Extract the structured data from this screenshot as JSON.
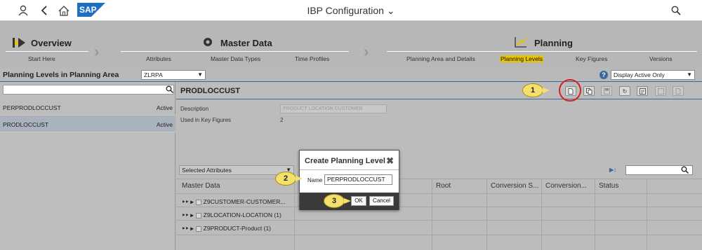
{
  "app": {
    "title": "IBP Configuration",
    "logo_text": "SAP",
    "brand_color": "#1f6fc1"
  },
  "roadmap": {
    "phases": [
      {
        "label": "Overview"
      },
      {
        "label": "Master Data"
      },
      {
        "label": "Planning"
      }
    ],
    "steps": [
      {
        "label": "Start Here"
      },
      {
        "label": "Attributes"
      },
      {
        "label": "Master Data Types"
      },
      {
        "label": "Time Profiles"
      },
      {
        "label": "Planning Area and Details"
      },
      {
        "label": "Planning Levels",
        "active": true
      },
      {
        "label": "Key Figures"
      },
      {
        "label": "Versions"
      }
    ],
    "active_color": "#e9c400"
  },
  "toolbar": {
    "heading": "Planning Levels in Planning Area",
    "planning_area": "ZLRPA",
    "display_filter": "Display Active Only"
  },
  "left_panel": {
    "search_placeholder": "",
    "items": [
      {
        "name": "PERPRODLOCCUST",
        "status": "Active"
      },
      {
        "name": "PRODLOCCUST",
        "status": "Active",
        "selected": true
      }
    ]
  },
  "detail": {
    "title": "PRODLOCCUST",
    "description_label": "Description",
    "description_value": "PRODUCT LOCATION CUSTOMER",
    "used_in_label": "Used in Key Figures",
    "used_in_value": "2",
    "attributes_filter": "Selected Attributes",
    "columns": [
      "Master Data",
      "Root",
      "Conversion S...",
      "Conversion...",
      "Status"
    ],
    "rows": [
      {
        "label": "Z9CUSTOMER-CUSTOMER..."
      },
      {
        "label": "Z9LOCATION-LOCATION (1)"
      },
      {
        "label": "Z9PRODUCT-Product (1)"
      }
    ]
  },
  "dialog": {
    "title": "Create Planning Level",
    "name_label": "Name",
    "name_value": "PERPRODLOCCUST",
    "ok_label": "OK",
    "cancel_label": "Cancel"
  },
  "callouts": {
    "one": "1",
    "two": "2",
    "three": "3"
  }
}
